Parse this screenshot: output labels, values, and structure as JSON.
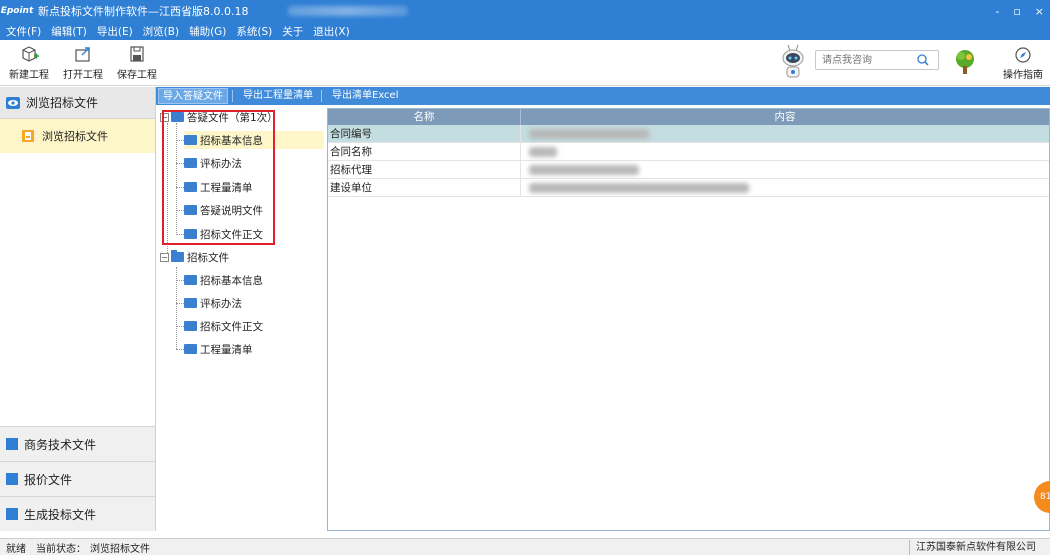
{
  "window": {
    "logo": "Epoint",
    "title": "新点投标文件制作软件—江西省版8.0.0.18",
    "controls": [
      "-",
      "▫",
      "×"
    ]
  },
  "menu": [
    "文件(F)",
    "编辑(T)",
    "导出(E)",
    "浏览(B)",
    "辅助(G)",
    "系统(S)",
    "关于",
    "退出(X)"
  ],
  "toolbar": {
    "new_label": "新建工程",
    "open_label": "打开工程",
    "save_label": "保存工程",
    "search_placeholder": "请点我咨询",
    "guide_label": "操作指南"
  },
  "leftnav": {
    "header": "浏览招标文件",
    "selected": "浏览招标文件",
    "bottom_items": [
      "商务技术文件",
      "报价文件",
      "生成投标文件"
    ]
  },
  "subbar": {
    "buttons": [
      "导入答疑文件",
      "导出工程量清单",
      "导出清单Excel"
    ]
  },
  "tree": {
    "root1": "答疑文件（第1次）",
    "root1_children": [
      "招标基本信息",
      "评标办法",
      "工程量清单",
      "答疑说明文件",
      "招标文件正文"
    ],
    "root2": "招标文件",
    "root2_children": [
      "招标基本信息",
      "评标办法",
      "招标文件正文",
      "工程量清单"
    ]
  },
  "grid": {
    "col_name": "名称",
    "col_content": "内容",
    "rows": [
      "合同编号",
      "合同名称",
      "招标代理",
      "建设单位"
    ]
  },
  "status": {
    "ready": "就绪",
    "state_label": "当前状态：",
    "state_value": "浏览招标文件",
    "company": "江苏国泰新点软件有限公司"
  },
  "float_badge": "81",
  "colors": {
    "primary": "#2f7fd4",
    "highlight": "#e0202a",
    "selected_row": "#c3dde0",
    "nav_selected": "#fdf6c8"
  }
}
